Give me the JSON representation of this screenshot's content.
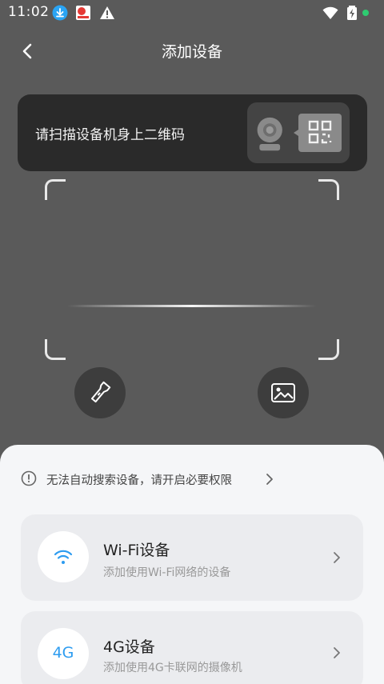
{
  "status_bar": {
    "time": "11:02",
    "icons": [
      "download-icon",
      "app-notification-icon",
      "warning-icon",
      "wifi-icon",
      "battery-charging-icon",
      "green-dot-indicator"
    ]
  },
  "header": {
    "title": "添加设备",
    "back_icon": "chevron-left-icon"
  },
  "hint": {
    "text": "请扫描设备机身上二维码",
    "art_icons": [
      "camera-icon",
      "qr-code-icon"
    ]
  },
  "scanner": {
    "flash_icon": "flashlight-icon",
    "gallery_icon": "image-icon"
  },
  "sheet": {
    "permission_text": "无法自动搜索设备，请开启必要权限",
    "devices": [
      {
        "title": "Wi-Fi设备",
        "subtitle": "添加使用Wi-Fi网络的设备",
        "icon": "wifi-icon"
      },
      {
        "title": "4G设备",
        "subtitle": "添加使用4G卡联网的摄像机",
        "icon_label": "4G"
      }
    ]
  },
  "colors": {
    "background": "#5a5a5a",
    "banner": "#2a2a2a",
    "accent_blue": "#2d9cf0",
    "sheet": "#f5f6f8",
    "card": "#ebecef",
    "status_dot": "#2ecc71"
  }
}
